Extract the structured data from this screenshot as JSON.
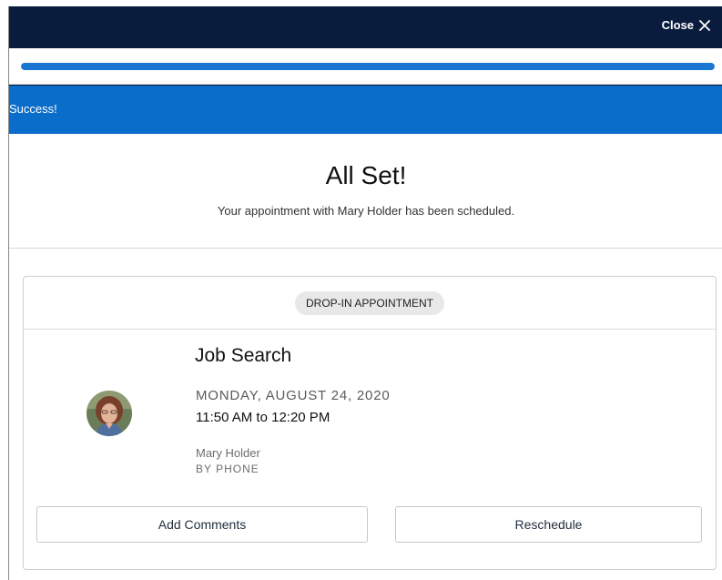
{
  "dialog": {
    "close_label": "Close",
    "close_icon": "close-icon"
  },
  "progress": {
    "fraction": 1.0,
    "color": "#1976d2"
  },
  "alert": {
    "text": "Success!",
    "color": "#0a6dc9"
  },
  "hero": {
    "title": "All Set!",
    "message": "Your appointment with Mary Holder has been scheduled."
  },
  "appointment": {
    "type_badge": "DROP-IN APPOINTMENT",
    "title": "Job Search",
    "date": "MONDAY, AUGUST 24, 2020",
    "time": "11:50 AM to 12:20 PM",
    "advisor": "Mary Holder",
    "method": "BY PHONE"
  },
  "actions": {
    "add_comments": "Add Comments",
    "reschedule": "Reschedule"
  },
  "colors": {
    "header_bg": "#0a1c3e",
    "accent": "#0a6dc9"
  }
}
